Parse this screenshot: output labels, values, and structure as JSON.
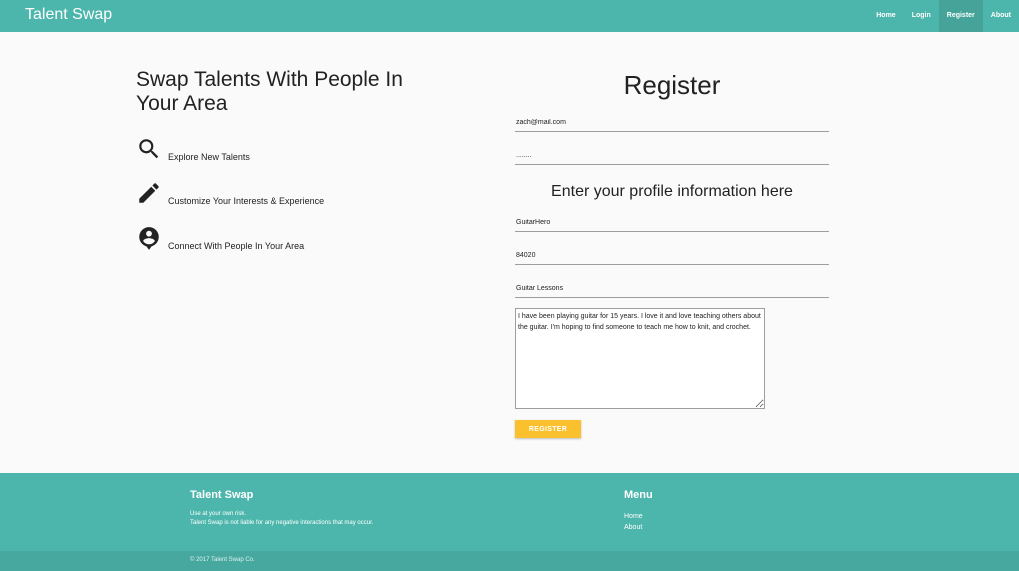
{
  "nav": {
    "brand": "Talent Swap",
    "links": [
      {
        "label": "Home"
      },
      {
        "label": "Login"
      },
      {
        "label": "Register",
        "active": true
      },
      {
        "label": "About"
      }
    ]
  },
  "hero": {
    "title": "Swap Talents With People In Your Area",
    "features": [
      {
        "icon": "search-icon",
        "text": "Explore New Talents"
      },
      {
        "icon": "pencil-icon",
        "text": "Customize Your Interests & Experience"
      },
      {
        "icon": "person-pin-icon",
        "text": "Connect With People In Your Area"
      }
    ]
  },
  "register": {
    "title": "Register",
    "email": "zach@mail.com",
    "password": "........",
    "profile_title": "Enter your profile information here",
    "username": "GuitarHero",
    "zip": "84020",
    "talent": "Guitar Lessons",
    "bio": "I have been playing guitar for 15 years. I love it and love teaching others about the guitar. I'm hoping to find someone to teach me how to knit, and crochet.",
    "button": "REGISTER"
  },
  "footer": {
    "brand": "Talent Swap",
    "line1": "Use at your own risk.",
    "line2": "Talent Swap is not liable for any negative interactions that may occur.",
    "menu_title": "Menu",
    "menu": [
      "Home",
      "About"
    ],
    "copyright": "© 2017 Talent Swap Co."
  },
  "colors": {
    "primary": "#4db6ac",
    "accent": "#fbc02d",
    "background": "#fafafa"
  }
}
